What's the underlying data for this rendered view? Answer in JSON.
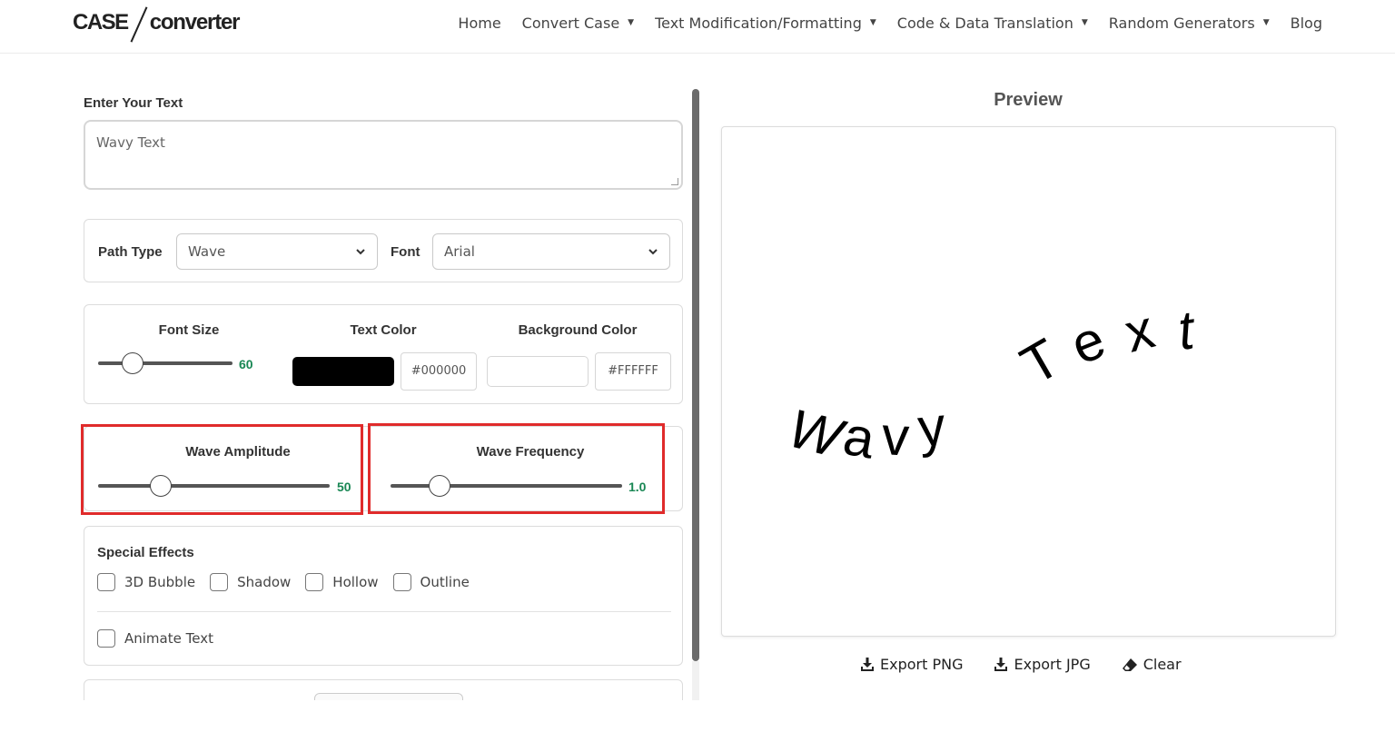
{
  "brand": {
    "logo_left": "CASE",
    "logo_right": "converter"
  },
  "nav": {
    "items": [
      {
        "label": "Home",
        "has_caret": false
      },
      {
        "label": "Convert Case",
        "has_caret": true
      },
      {
        "label": "Text Modification/Formatting",
        "has_caret": true
      },
      {
        "label": "Code & Data Translation",
        "has_caret": true
      },
      {
        "label": "Random Generators",
        "has_caret": true
      },
      {
        "label": "Blog",
        "has_caret": false
      }
    ],
    "caret_glyph": "▼"
  },
  "editor": {
    "input_label": "Enter Your Text",
    "input_value": "Wavy Text",
    "path_type_label": "Path Type",
    "path_type_value": "Wave",
    "font_label": "Font",
    "font_value": "Arial",
    "font_size_label": "Font Size",
    "font_size_value": "60",
    "font_size_fraction": 0.26,
    "text_color_label": "Text Color",
    "text_color_hex": "#000000",
    "bg_color_label": "Background Color",
    "bg_color_hex": "#FFFFFF",
    "wave_amplitude_label": "Wave Amplitude",
    "wave_amplitude_value": "50",
    "wave_amplitude_fraction": 0.27,
    "wave_frequency_label": "Wave Frequency",
    "wave_frequency_value": "1.0",
    "wave_frequency_fraction": 0.21,
    "special_effects_label": "Special Effects",
    "effects": [
      {
        "label": "3D Bubble",
        "checked": false
      },
      {
        "label": "Shadow",
        "checked": false
      },
      {
        "label": "Hollow",
        "checked": false
      },
      {
        "label": "Outline",
        "checked": false
      }
    ],
    "animate_label": "Animate Text",
    "animate_checked": false
  },
  "preview": {
    "title": "Preview",
    "text": "Wavy Text",
    "letters": [
      "W",
      "a",
      "v",
      "y",
      " ",
      "T",
      "e",
      "x",
      "t"
    ]
  },
  "actions": {
    "export_png": "Export PNG",
    "export_jpg": "Export JPG",
    "clear": "Clear"
  },
  "colors": {
    "accent_green": "#198754",
    "highlight_red": "#e02b2b",
    "text_color": "#000000",
    "background": "#FFFFFF"
  },
  "icons": {
    "export_png": "download-icon",
    "export_jpg": "download-icon",
    "clear": "eraser-icon"
  }
}
